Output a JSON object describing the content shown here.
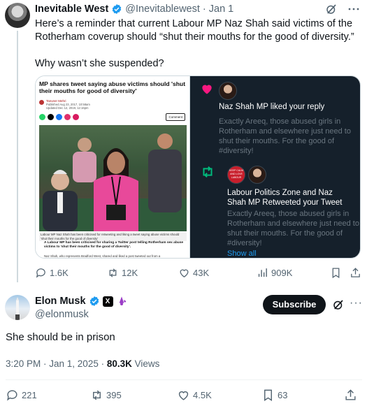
{
  "quoted": {
    "name": "Inevitable West",
    "handle": "@Inevitablewest",
    "sep": "·",
    "date": "Jan 1",
    "text_line1": "Here’s a reminder that current Labour MP Naz Shah said victims of the Rotherham coverup should “shut their mouths for the good of diversity.”",
    "text_line2": "Why wasn’t she suspended?",
    "article": {
      "headline": "MP shares tweet saying abuse victims should 'shut their mouths for good of diversity'",
      "author": "Tanveer Mehri",
      "published": "Published Aug 23, 2017, 10:58am",
      "updated": "Updated Dec 12, 2019, 12:16pm",
      "comment_btn": "Comment",
      "caption": "Labour MP Naz Shah has been criticised for retweeting and liking a tweet saying abuse victims should 'shut their mouths for the good of diversity'",
      "lead": "A Labour MP has been criticised for sharing a Twitter post telling Rotherham sex abuse victims to 'shut their mouths for the good of diversity'.",
      "body": "Naz Shah, who represents Bradford West, shared and liked a post tweeted out from a"
    },
    "notif1_title": "Naz Shah MP liked your reply",
    "notif1_text": "Exactly Areeq, those abused girls in Rotherham and elsewhere just need to shut their mouths. For the good of #diversity!",
    "notif2_avatar_text": "KEEP CALM AND LOVE LABOUR",
    "notif2_title": "Labour Politics Zone and Naz Shah MP Retweeted your Tweet",
    "notif2_text": "Exactly Areeq, those abused girls in Rotherham and elsewhere just need to shut their mouths. For the good of #diversity!",
    "show_all": "Show all",
    "stats": {
      "replies": "1.6K",
      "reposts": "12K",
      "likes": "43K",
      "views": "909K"
    }
  },
  "main": {
    "name": "Elon Musk",
    "handle": "@elonmusk",
    "subscribe_label": "Subscribe",
    "more": "···",
    "text": "She should be in prison",
    "time": "3:20 PM · Jan 1, 2025 · ",
    "views_count": "80.3K",
    "views_label": " Views",
    "stats": {
      "replies": "221",
      "reposts": "395",
      "likes": "4.5K",
      "bookmarks": "63"
    }
  },
  "colors": {
    "verified": "#1d9bf0",
    "dark_panel": "#15202b",
    "muted": "#536471",
    "heart": "#f91880",
    "retweet": "#00ba7c"
  }
}
